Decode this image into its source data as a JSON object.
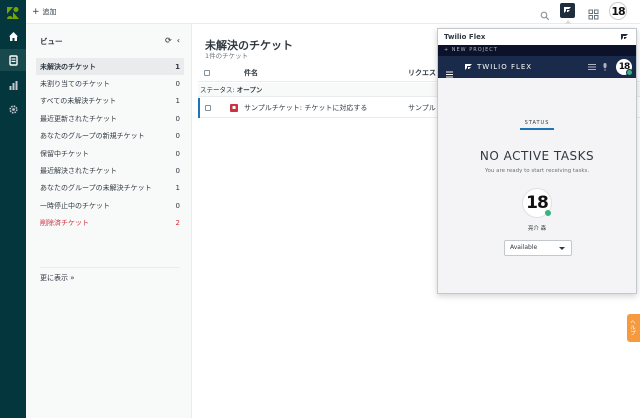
{
  "topbar": {
    "add_label": "追加"
  },
  "rail": {
    "icons": [
      "zendesk-logo-icon",
      "home-icon",
      "views-icon",
      "reports-icon",
      "admin-gear-icon"
    ]
  },
  "views": {
    "heading": "ビュー",
    "items": [
      {
        "label": "未解決のチケット",
        "count": "1"
      },
      {
        "label": "未割り当てのチケット",
        "count": "0"
      },
      {
        "label": "すべての未解決チケット",
        "count": "1"
      },
      {
        "label": "最近更新されたチケット",
        "count": "0"
      },
      {
        "label": "あなたのグループの新規チケット",
        "count": "0"
      },
      {
        "label": "保留中チケット",
        "count": "0"
      },
      {
        "label": "最近解決されたチケット",
        "count": "0"
      },
      {
        "label": "あなたのグループの未解決チケット",
        "count": "1"
      },
      {
        "label": "一時停止中のチケット",
        "count": "0"
      },
      {
        "label": "削除済チケット",
        "count": "2"
      }
    ],
    "more_label": "更に表示 »"
  },
  "main": {
    "title": "未解決のチケット",
    "subtitle": "1件のチケット",
    "columns": {
      "subject": "件名",
      "requester": "リクエス"
    },
    "group_prefix": "ステータス: ",
    "group_value": "オープン",
    "rows": [
      {
        "subject": "サンプルチケット: チケットに対応する",
        "requester": "サンプル"
      }
    ]
  },
  "help": {
    "label": "ヘルプ"
  },
  "flex": {
    "window_title": "Twilio Flex",
    "new_project": "+ NEW PROJECT",
    "brand": "TWILIO FLEX",
    "avatar_text": "18",
    "status_tab": "STATUS",
    "no_tasks": "NO ACTIVE TASKS",
    "ready_text": "You are ready to start receiving tasks.",
    "agent_name": "亮介 森",
    "availability": "Available"
  },
  "colors": {
    "rail": "#03363d",
    "flex_bar": "#192a4a",
    "accent": "#1f73b7",
    "deleted": "#cc3340",
    "help_tab": "#f79a3e",
    "online": "#36b37e"
  }
}
